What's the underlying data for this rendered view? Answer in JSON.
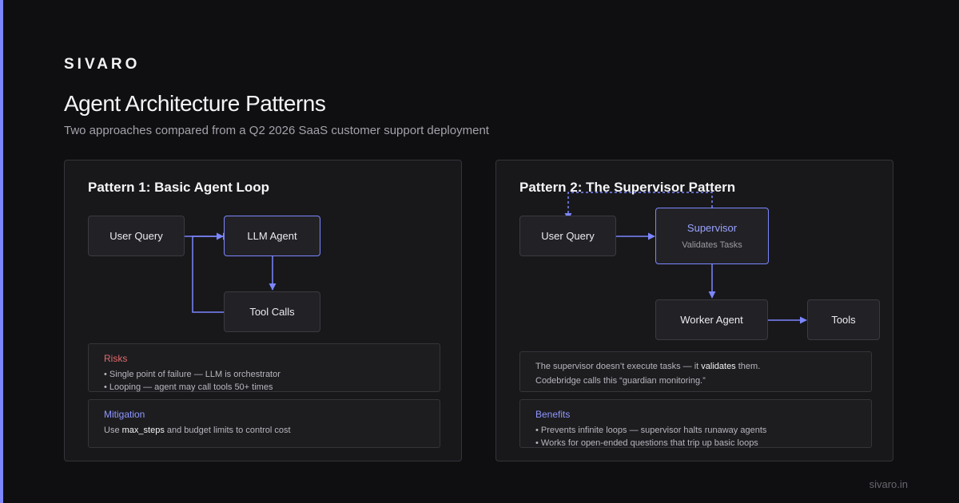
{
  "brand": "SIVARO",
  "title": "Agent Architecture Patterns",
  "subtitle": "Two approaches compared from a Q2 2026 SaaS customer support deployment",
  "footer_url": "sivaro.in",
  "colors": {
    "accent": "#7c86ff",
    "risk": "#e06a6a",
    "benefit": "#8f97ff",
    "background": "#0f0f11",
    "panel": "#18181b"
  },
  "pattern1": {
    "title": "Pattern 1: Basic Agent Loop",
    "nodes": {
      "user_query": "User Query",
      "llm_agent": "LLM Agent",
      "tool_calls": "Tool Calls"
    },
    "risks": {
      "heading": "Risks",
      "items": [
        "• Single point of failure — LLM is orchestrator",
        "• Looping — agent may call tools 50+ times"
      ]
    },
    "mitigation": {
      "heading": "Mitigation",
      "prefix": "Use ",
      "highlight": "max_steps",
      "suffix": " and budget limits to control cost"
    }
  },
  "pattern2": {
    "title": "Pattern 2: The Supervisor Pattern",
    "nodes": {
      "user_query": "User Query",
      "supervisor": "Supervisor",
      "supervisor_sub": "Validates Tasks",
      "worker_agent": "Worker Agent",
      "tools": "Tools"
    },
    "note": {
      "line1_prefix": "The supervisor doesn’t execute tasks — it ",
      "line1_highlight": "validates",
      "line1_suffix": " them.",
      "line2": "Codebridge calls this “guardian monitoring.”"
    },
    "benefits": {
      "heading": "Benefits",
      "items": [
        "• Prevents infinite loops — supervisor halts runaway agents",
        "• Works for open-ended questions that trip up basic loops"
      ]
    }
  }
}
